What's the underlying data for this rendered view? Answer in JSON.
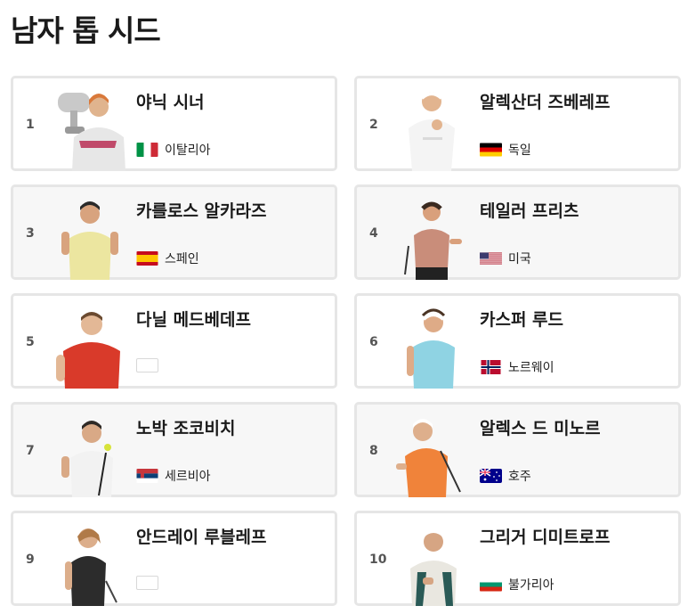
{
  "page": {
    "title": "남자 톱 시드"
  },
  "players": [
    {
      "rank": "1",
      "name": "야닉 시너",
      "country": "이탈리아",
      "flag": "italy"
    },
    {
      "rank": "2",
      "name": "알렉산더 즈베레프",
      "country": "독일",
      "flag": "germany"
    },
    {
      "rank": "3",
      "name": "카를로스 알카라즈",
      "country": "스페인",
      "flag": "spain"
    },
    {
      "rank": "4",
      "name": "테일러 프리츠",
      "country": "미국",
      "flag": "usa"
    },
    {
      "rank": "5",
      "name": "다닐 메드베데프",
      "country": "",
      "flag": "none"
    },
    {
      "rank": "6",
      "name": "카스퍼 루드",
      "country": "노르웨이",
      "flag": "norway"
    },
    {
      "rank": "7",
      "name": "노박 조코비치",
      "country": "세르비아",
      "flag": "serbia"
    },
    {
      "rank": "8",
      "name": "알렉스 드 미노르",
      "country": "호주",
      "flag": "australia"
    },
    {
      "rank": "9",
      "name": "안드레이 루블레프",
      "country": "",
      "flag": "none"
    },
    {
      "rank": "10",
      "name": "그리거 디미트로프",
      "country": "불가리아",
      "flag": "bulgaria"
    }
  ],
  "colors": {
    "card_border": "#e6e6e6",
    "card_shade": "#f7f7f7",
    "title": "#1a1a1a"
  }
}
